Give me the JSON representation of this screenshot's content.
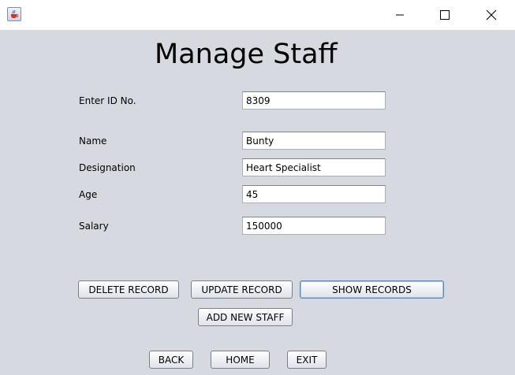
{
  "window": {
    "minimize_glyph": "—",
    "maximize_glyph": "☐",
    "close_glyph": "✕"
  },
  "form": {
    "title": "Manage Staff",
    "fields": {
      "id": {
        "label": "Enter ID No.",
        "value": "8309"
      },
      "name": {
        "label": "Name",
        "value": "Bunty"
      },
      "designation": {
        "label": "Designation",
        "value": "Heart Specialist"
      },
      "age": {
        "label": "Age",
        "value": "45"
      },
      "salary": {
        "label": "Salary",
        "value": "150000"
      }
    },
    "buttons": {
      "delete": "DELETE RECORD",
      "update": "UPDATE RECORD",
      "show": "SHOW RECORDS",
      "add": "ADD NEW STAFF",
      "back": "BACK",
      "home": "HOME",
      "exit": "EXIT"
    }
  },
  "colors": {
    "window_background": "#d6d9df",
    "titlebar_background": "#ffffff",
    "focus_border": "#5f82b8"
  },
  "icons": {
    "app": "java-coffee-cup-icon",
    "minimize": "minimize-icon",
    "maximize": "maximize-icon",
    "close": "close-icon"
  }
}
